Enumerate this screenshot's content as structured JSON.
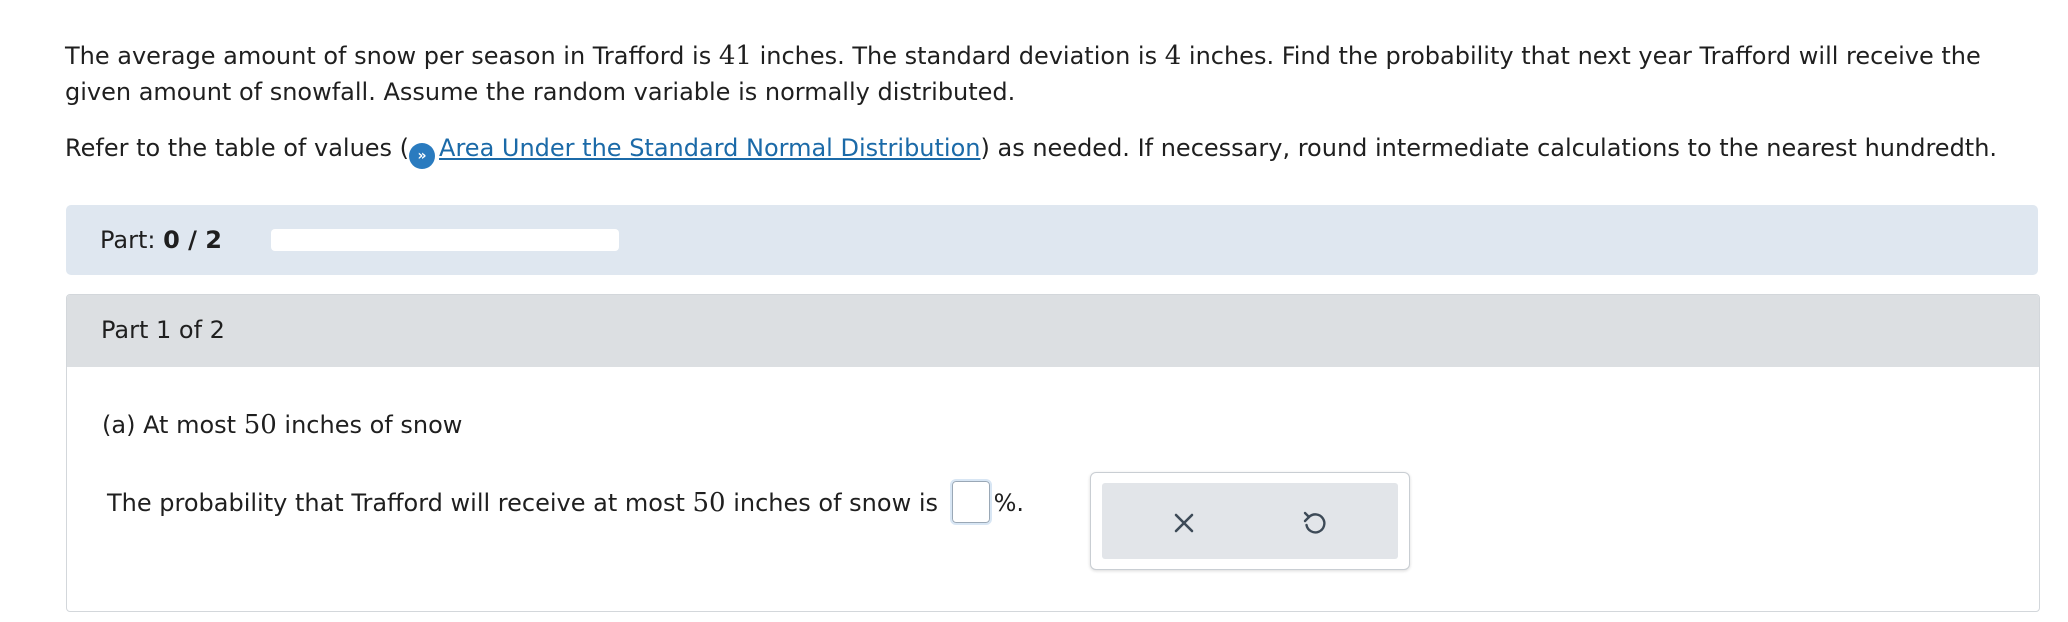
{
  "question": {
    "line1_pre": "The average amount of snow per season in Trafford is ",
    "mean": "41",
    "line1_mid": " inches. The standard deviation is ",
    "sd": "4",
    "line1_post": " inches. Find the probability that next year Trafford will receive the",
    "line2": "given amount of snowfall. Assume the random variable is normally distributed."
  },
  "reference": {
    "pre": "Refer to the table of values (",
    "icon": "info-icon",
    "link_text": "Area Under the Standard Normal Distribution",
    "post": ") as needed. If necessary, round intermediate calculations to the nearest hundredth."
  },
  "progress": {
    "label": "Part: ",
    "value_text": "0 / 2",
    "fraction": 0
  },
  "part": {
    "header": "Part 1 of 2",
    "sub_question_pre": "(a) At most ",
    "sub_question_num": "50",
    "sub_question_post": " inches of snow",
    "answer_pre": "The probability that Trafford will receive at most ",
    "answer_num": "50",
    "answer_mid": " inches of snow is ",
    "answer_value": "",
    "answer_post": "%."
  },
  "tools": {
    "clear_icon": "close-icon",
    "undo_icon": "undo-icon",
    "icon_color": "#3d4a57"
  },
  "colors": {
    "link": "#1b6aa8",
    "accent": "#2a7bbf",
    "progress_bg": "#dfe7f0",
    "part_header_bg": "#dcdfe2"
  }
}
